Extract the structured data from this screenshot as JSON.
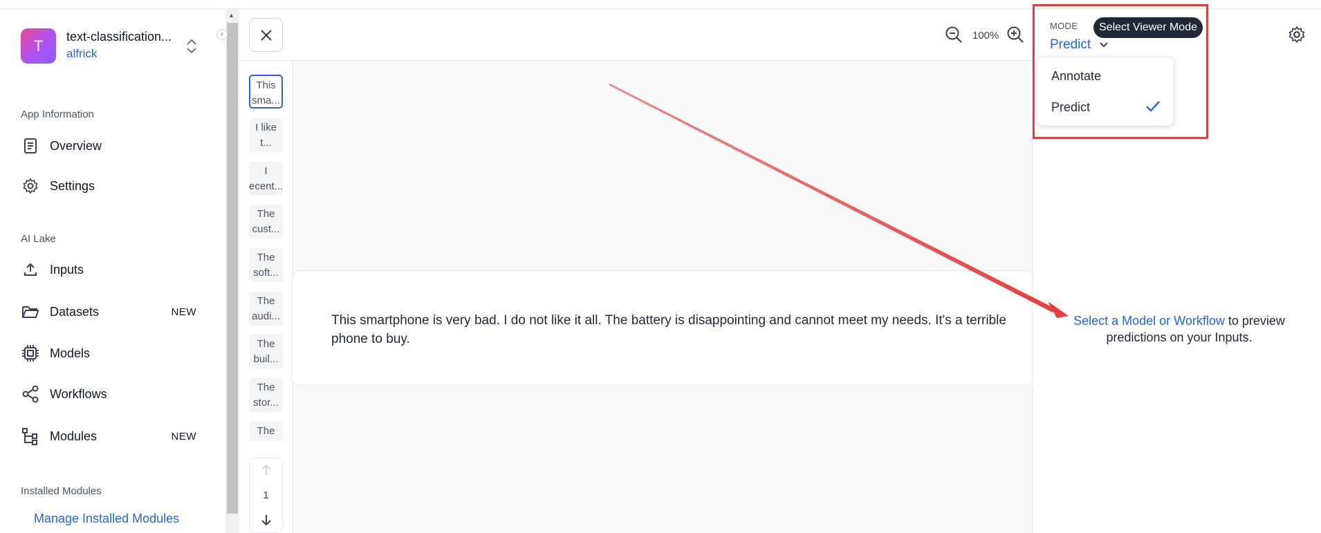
{
  "app": {
    "initial": "T",
    "name": "text-classification...",
    "owner": "alfrick"
  },
  "sidebar": {
    "section_app_info": "App Information",
    "items_app": [
      {
        "label": "Overview"
      },
      {
        "label": "Settings"
      }
    ],
    "section_ai_lake": "AI Lake",
    "items_lake": [
      {
        "label": "Inputs",
        "badge": ""
      },
      {
        "label": "Datasets",
        "badge": "NEW"
      },
      {
        "label": "Models",
        "badge": ""
      },
      {
        "label": "Workflows",
        "badge": ""
      },
      {
        "label": "Modules",
        "badge": "NEW"
      }
    ],
    "section_installed": "Installed Modules",
    "manage_link": "Manage Installed Modules"
  },
  "toolbar": {
    "zoom_level": "100%"
  },
  "thumbnails": [
    {
      "line1": "This",
      "line2": "sma..."
    },
    {
      "line1": "I like",
      "line2": "t..."
    },
    {
      "line1": "I",
      "line2": "ecent..."
    },
    {
      "line1": "The",
      "line2": "cust..."
    },
    {
      "line1": "The",
      "line2": "soft..."
    },
    {
      "line1": "The",
      "line2": "audi..."
    },
    {
      "line1": "The",
      "line2": "buil..."
    },
    {
      "line1": "The",
      "line2": "stor..."
    },
    {
      "line1": "The",
      "line2": ""
    }
  ],
  "pager": {
    "page": "1"
  },
  "input_text": "This smartphone is very bad. I do not like it all. The battery is disappointing and cannot meet my needs. It's a terrible phone to buy.",
  "right_panel": {
    "mode_label": "MODE",
    "mode_value": "Predict",
    "tooltip": "Select Viewer Mode",
    "options": [
      {
        "label": "Annotate"
      },
      {
        "label": "Predict"
      }
    ],
    "hint_link": "Select a Model or Workflow",
    "hint_rest": " to preview predictions on your Inputs."
  },
  "colors": {
    "accent": "#2563eb",
    "annotation_red": "#e53e3e"
  }
}
